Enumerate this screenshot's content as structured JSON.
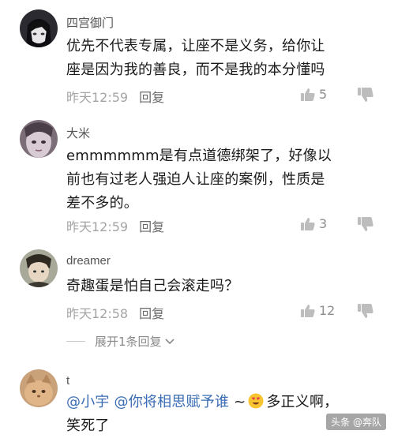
{
  "comments": [
    {
      "username": "四宫御门",
      "text_lines": [
        "优先不代表专属，让座不是义务，给你让",
        "座是因为我的善良，而不是我的本分懂吗"
      ],
      "time": "昨天12:59",
      "reply_label": "回复",
      "likes": "5"
    },
    {
      "username": "大米",
      "text_lines": [
        "emmmmmm是有点道德绑架了，好像以",
        "前也有过老人强迫人让座的案例，性质是",
        "差不多的。"
      ],
      "time": "昨天12:59",
      "reply_label": "回复",
      "likes": "3"
    },
    {
      "username": "dreamer",
      "text_lines": [
        "奇趣蛋是怕自己会滚走吗？"
      ],
      "time": "昨天12:58",
      "reply_label": "回复",
      "likes": "12"
    },
    {
      "username": "t",
      "mention_1": "@小宇",
      "mention_2": "@你将相思赋予谁",
      "tilde": "~",
      "text_after_emoji": "多正义啊，",
      "text_line_2": "笑死了"
    }
  ],
  "expand_replies_label": "展开1条回复",
  "icons": {
    "like": "thumbs-up-icon",
    "dislike": "thumbs-down-icon",
    "expand": "chevron-down-icon",
    "emoji": "heart-eyes-emoji"
  },
  "watermark": "头条 @奔队",
  "colors": {
    "mention": "#3a6cb4",
    "meta": "#a4a4a4",
    "text": "#1a1a1a"
  }
}
